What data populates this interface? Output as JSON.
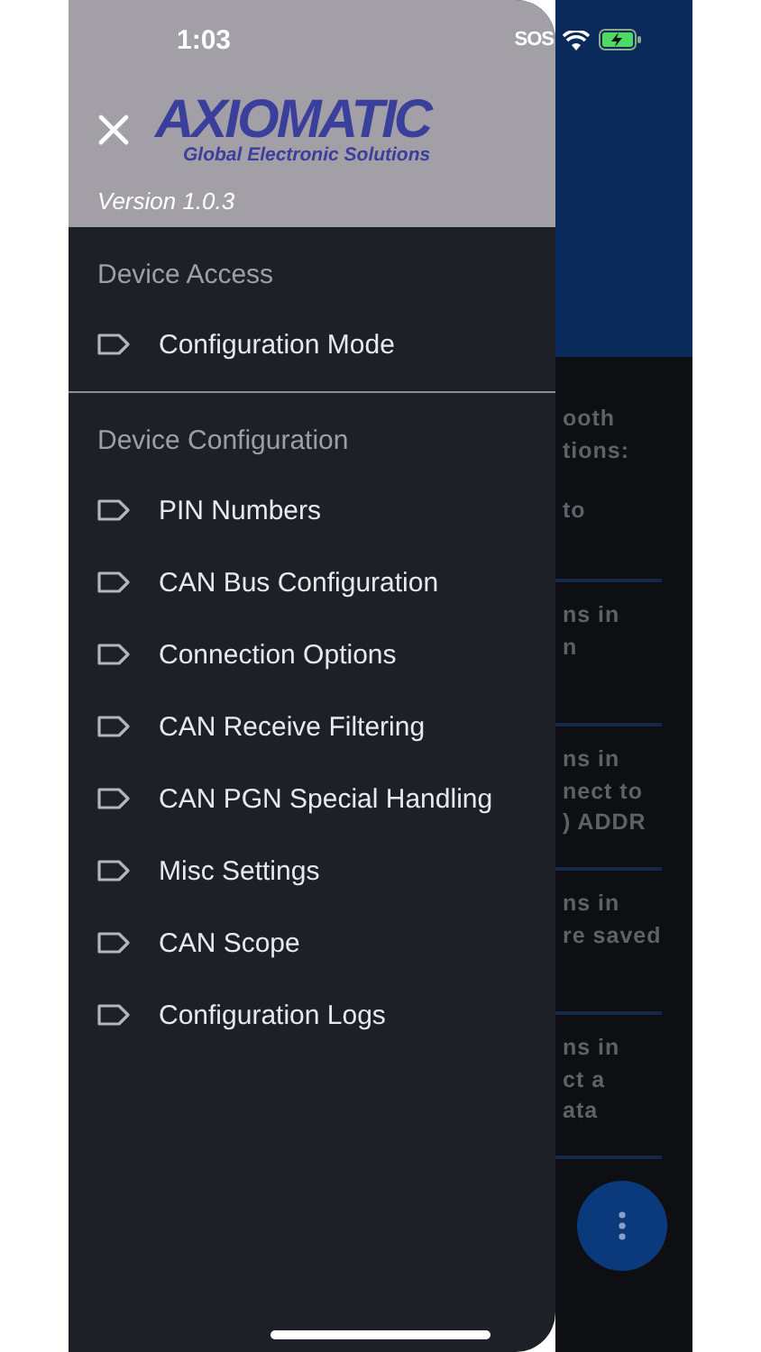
{
  "status_bar": {
    "time": "1:03",
    "carrier": "SOS"
  },
  "drawer": {
    "logo": {
      "brand": "AXIOMATIC",
      "tagline": "Global Electronic Solutions"
    },
    "version": "Version 1.0.3",
    "sections": [
      {
        "title": "Device Access",
        "items": [
          {
            "label": "Configuration Mode"
          }
        ]
      },
      {
        "title": "Device Configuration",
        "items": [
          {
            "label": "PIN Numbers"
          },
          {
            "label": "CAN Bus Configuration"
          },
          {
            "label": "Connection Options"
          },
          {
            "label": "CAN Receive Filtering"
          },
          {
            "label": "CAN PGN Special Handling"
          },
          {
            "label": "Misc Settings"
          },
          {
            "label": "CAN Scope"
          },
          {
            "label": "Configuration Logs"
          }
        ]
      }
    ]
  },
  "background": {
    "cards": [
      {
        "lines": [
          "ooth",
          "tions:",
          "to"
        ]
      },
      {
        "lines": [
          "ns in",
          "n"
        ]
      },
      {
        "lines": [
          "ns in",
          "nect to",
          ") ADDR"
        ]
      },
      {
        "lines": [
          "ns in",
          "re saved"
        ]
      },
      {
        "lines": [
          "ns in",
          "ct a",
          "ata"
        ]
      }
    ]
  }
}
